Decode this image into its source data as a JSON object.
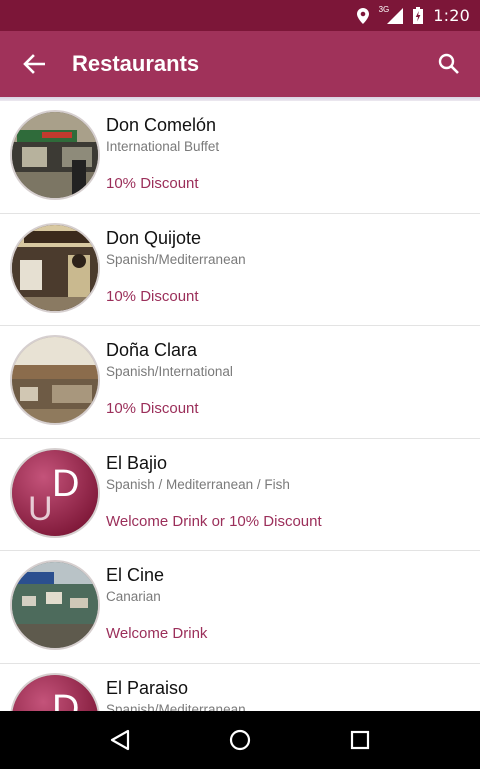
{
  "status_bar": {
    "time": "1:20",
    "network_label": "3G",
    "icons": [
      "location-icon",
      "signal-icon",
      "battery-icon"
    ]
  },
  "app_bar": {
    "title": "Restaurants",
    "back_icon": "arrow-left-icon",
    "search_icon": "search-icon"
  },
  "restaurants": [
    {
      "name": "Don Comelón",
      "cuisine": "International Buffet",
      "offer": "10% Discount",
      "image": "photo"
    },
    {
      "name": "Don Quijote",
      "cuisine": "Spanish/Mediterranean",
      "offer": "10% Discount",
      "image": "photo"
    },
    {
      "name": "Doña Clara",
      "cuisine": "Spanish/International",
      "offer": "10% Discount",
      "image": "photo"
    },
    {
      "name": "El Bajio",
      "cuisine": "Spanish / Mediterranean / Fish",
      "offer": "Welcome Drink or 10% Discount",
      "image": "logo"
    },
    {
      "name": "El Cine",
      "cuisine": "Canarian",
      "offer": "Welcome Drink",
      "image": "photo"
    },
    {
      "name": "El Paraiso",
      "cuisine": "Spanish/Mediterranean",
      "offer": "",
      "image": "logo"
    }
  ],
  "logo_text": {
    "letter_top": "D",
    "letter_bottom": "U"
  },
  "nav_bar": {
    "icons": [
      "back-triangle-icon",
      "home-circle-icon",
      "recents-square-icon"
    ]
  },
  "colors": {
    "status_bar": "#7c1638",
    "app_bar": "#a0325a",
    "accent_text": "#9b2f5a"
  }
}
